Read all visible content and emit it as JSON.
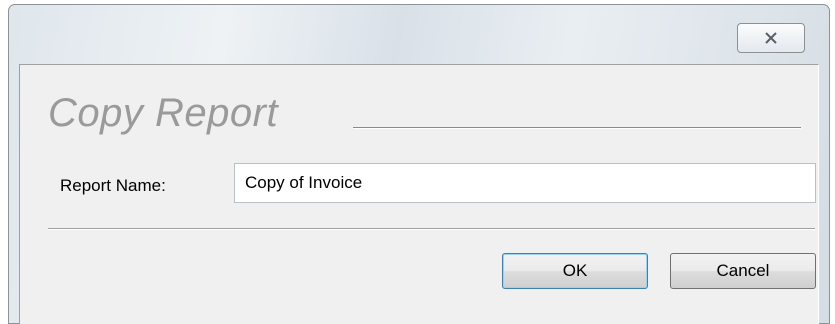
{
  "window": {
    "close_icon": "close-x-icon"
  },
  "dialog": {
    "heading": "Copy Report",
    "report_name_label": "Report Name:",
    "report_name_value": "Copy of Invoice",
    "ok_label": "OK",
    "cancel_label": "Cancel"
  },
  "colors": {
    "heading_text": "#9a9a9a",
    "client_background": "#f0f0f0",
    "default_button_border": "#3c7fb1"
  }
}
